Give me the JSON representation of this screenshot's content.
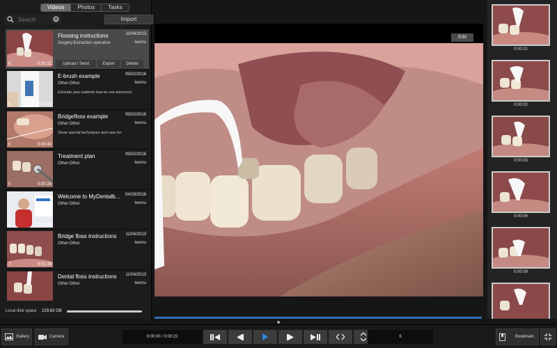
{
  "tabs": [
    "Videos",
    "Photos",
    "Tasks"
  ],
  "search": {
    "placeholder": "Search"
  },
  "import_label": "Import",
  "videos": [
    {
      "title": "Flossing instructions",
      "date": "11/04/2013",
      "category": "Surgery:Extraction operative",
      "user": "teemu",
      "count": "6",
      "duration": "0:00:22",
      "description": "",
      "actions": [
        "Upload / Send",
        "Export",
        "Delete"
      ]
    },
    {
      "title": "E-brush example",
      "date": "05/02/2016",
      "category": "Other:Other",
      "user": "teemu",
      "count": "6",
      "duration": "0:00:35",
      "description": "Educate your patients how-to use electronic"
    },
    {
      "title": "Bridgefloss example",
      "date": "05/02/2016",
      "category": "Other:Other",
      "user": "teemu",
      "count": "0",
      "duration": "0:00:40",
      "description": "Show special techniques and care for"
    },
    {
      "title": "Treatment plan",
      "date": "05/02/2016",
      "category": "Other:Other",
      "user": "teemu",
      "count": "5",
      "duration": "0:00:28",
      "description": ""
    },
    {
      "title": "Welcome to MyDentalb...",
      "date": "04/29/2016",
      "category": "Other:Other",
      "user": "teemu",
      "count": "0",
      "duration": "0:02:10",
      "description": ""
    },
    {
      "title": "Bridge floss instructions",
      "date": "11/04/2013",
      "category": "Other:Other",
      "user": "teemu",
      "count": "7",
      "duration": "0:01:39",
      "description": ""
    },
    {
      "title": "Dental floss instructions",
      "date": "11/04/2013",
      "category": "Other:Other",
      "user": "teemu",
      "count": "",
      "duration": "",
      "description": ""
    }
  ],
  "disk": {
    "label": "Local disk space",
    "value": "229.63 GB"
  },
  "edit_label": "Edit",
  "frames": [
    "0:00:01",
    "0:00:02",
    "0:00:03",
    "0:00:06",
    "0:00:09",
    ""
  ],
  "bottom": {
    "gallery_label": "Gallery",
    "camera_label": "Camera",
    "timecode": "0:00:00 / 0:00:22",
    "frame_count": "6",
    "bookmark_label": "Bookmark"
  },
  "colors": {
    "accent": "#2d6fb4",
    "selected_row": "#4a4a4a"
  }
}
